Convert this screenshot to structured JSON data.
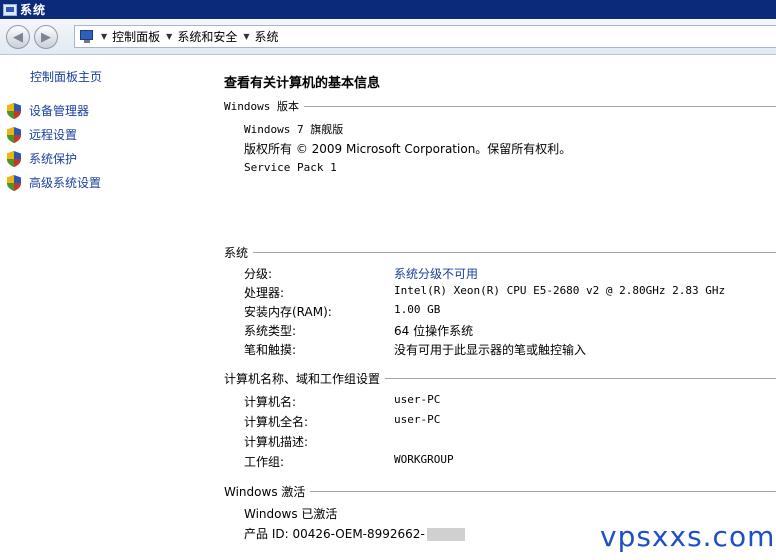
{
  "window": {
    "title": "系统"
  },
  "address": {
    "crumbs": [
      "控制面板",
      "系统和安全",
      "系统"
    ]
  },
  "sidebar": {
    "home": "控制面板主页",
    "tasks": [
      {
        "label": "设备管理器",
        "icon": "uac-shield-icon"
      },
      {
        "label": "远程设置",
        "icon": "uac-shield-icon"
      },
      {
        "label": "系统保护",
        "icon": "uac-shield-icon"
      },
      {
        "label": "高级系统设置",
        "icon": "uac-shield-icon"
      }
    ]
  },
  "main": {
    "title": "查看有关计算机的基本信息",
    "edition": {
      "heading": "Windows 版本",
      "name": "Windows 7 旗舰版",
      "copyright": "版权所有 © 2009 Microsoft Corporation。保留所有权利。",
      "sp": "Service Pack 1"
    },
    "system": {
      "heading": "系统",
      "rows": [
        {
          "k": "分级:",
          "v": "系统分级不可用"
        },
        {
          "k": "处理器:",
          "v": "Intel(R) Xeon(R) CPU E5-2680 v2 @ 2.80GHz   2.83 GHz"
        },
        {
          "k": "安装内存(RAM):",
          "v": "1.00 GB"
        },
        {
          "k": "系统类型:",
          "v": "64 位操作系统"
        },
        {
          "k": "笔和触摸:",
          "v": "没有可用于此显示器的笔或触控输入"
        }
      ]
    },
    "computer": {
      "heading": "计算机名称、域和工作组设置",
      "rows": [
        {
          "k": "计算机名:",
          "v": "user-PC"
        },
        {
          "k": "计算机全名:",
          "v": "user-PC"
        },
        {
          "k": "计算机描述:",
          "v": ""
        },
        {
          "k": "工作组:",
          "v": "WORKGROUP"
        }
      ]
    },
    "activation": {
      "heading": "Windows 激活",
      "status": "Windows 已激活",
      "product_id": "产品 ID: 00426-OEM-8992662-"
    }
  },
  "watermark": "vpsxxs.com"
}
